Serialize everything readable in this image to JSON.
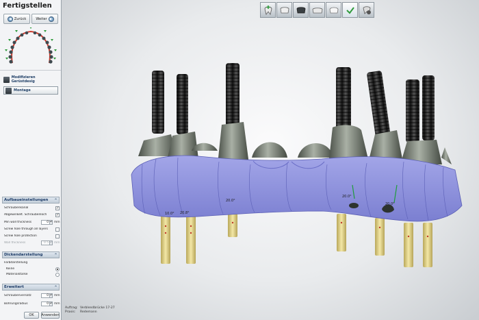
{
  "panel": {
    "title": "Fertigstellen",
    "back_label": "Zurück",
    "next_label": "Weiter"
  },
  "steps": {
    "modify": "Modifizieren Gerüstdesig",
    "mount": "Montage"
  },
  "settings": {
    "header": "Aufbaueinstellungen",
    "screw_channel": {
      "label": "Schraubenkanal",
      "checked": true
    },
    "angled_screw": {
      "label": "Abgewinkelt. Schraubenloch",
      "checked": true
    },
    "min_wall": {
      "label": "Min wall thickness",
      "value": "0",
      "unit": "mm"
    },
    "screw_through": {
      "label": "Screw hole through all layers",
      "checked": false
    },
    "screw_protect": {
      "label": "Screw hole protection",
      "checked": false
    },
    "wall_thickness": {
      "label": "Wall thickness",
      "value": "0.5",
      "unit": "mm"
    }
  },
  "display": {
    "header": "Dickendarstellung",
    "group_label": "Farbdarstellung",
    "opt_none": "Keine",
    "opt_material": "Materialstärke",
    "selected": "Keine"
  },
  "extended": {
    "header": "Erweitert",
    "screw_offset": {
      "label": "Schraubenversatz",
      "value": "0",
      "unit": "mm"
    },
    "hole_radius": {
      "label": "Bohrungsradius",
      "value": "0",
      "unit": "mm"
    }
  },
  "buttons": {
    "ok": "OK",
    "apply": "Anwenden"
  },
  "toolbar": {
    "icons": [
      "tooth-add-icon",
      "crown-icon",
      "dark-crown-icon",
      "bridge-icon",
      "crown-outline-icon",
      "check-icon",
      "tooth-gear-icon"
    ],
    "active_index": 5
  },
  "viewport": {
    "angle_labels": [
      "10.0°",
      "20.8°",
      "20.0°",
      "20.0°",
      "20.0°"
    ],
    "info": {
      "order_key": "Auftrag:",
      "order_value": "Verblendbrücke 17-27",
      "practice_key": "Praxis:",
      "practice_value": "Redemann"
    }
  },
  "colors": {
    "framework_purple": "#8f93de",
    "abutment_metal": "#6b7368",
    "implant_post": "#e6d58a",
    "screw_black": "#262626",
    "accent_blue": "#1b3a66"
  }
}
